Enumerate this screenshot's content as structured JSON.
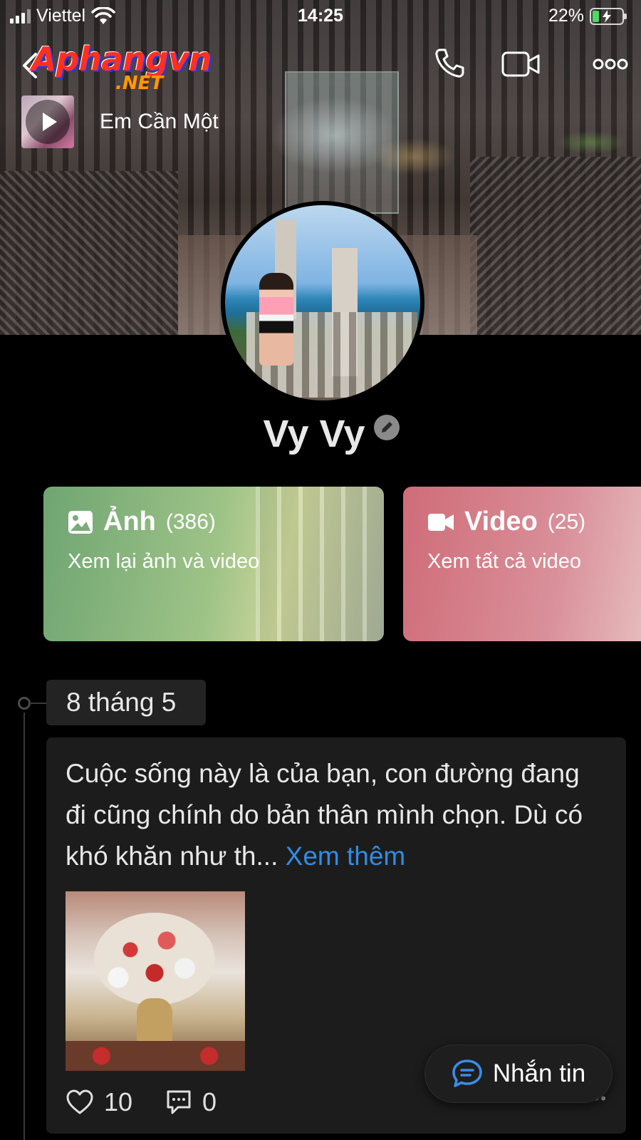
{
  "status_bar": {
    "carrier": "Viettel",
    "time": "14:25",
    "battery_percent": "22%",
    "battery_level": 0.22
  },
  "header": {
    "logo_main": "Aphangvn",
    "logo_sub": ".NET",
    "icons": [
      "back-icon",
      "phone-icon",
      "video-call-icon",
      "more-icon"
    ]
  },
  "music": {
    "song_title": "Em Cần Một"
  },
  "profile": {
    "name": "Vy Vy"
  },
  "cards": {
    "photos": {
      "label": "Ảnh",
      "count": "(386)",
      "subtitle": "Xem lại ảnh và video"
    },
    "videos": {
      "label": "Video",
      "count": "(25)",
      "subtitle": "Xem tất cả video"
    }
  },
  "timeline": {
    "date": "8 tháng 5",
    "post": {
      "text": "Cuộc sống này là của bạn, con đường đang đi cũng chính do bản thân mình chọn. Dù có khó khăn như th...",
      "see_more": "Xem thêm",
      "likes": "10",
      "comments": "0"
    }
  },
  "message_button": {
    "label": "Nhắn tin"
  },
  "colors": {
    "link": "#2f8de4",
    "photo_card": "#6fa572",
    "video_card": "#cf6c78",
    "battery": "#4cd964"
  }
}
